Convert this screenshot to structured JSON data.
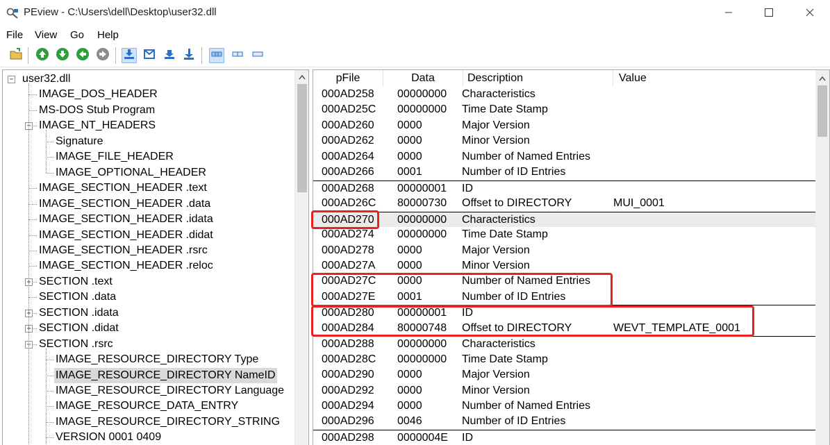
{
  "window": {
    "title": "PEview - C:\\Users\\dell\\Desktop\\user32.dll",
    "minimize_icon": "minimize-icon",
    "maximize_icon": "maximize-icon",
    "close_icon": "close-icon"
  },
  "menu": [
    "File",
    "View",
    "Go",
    "Help"
  ],
  "toolbar": {
    "buttons": [
      "open-file-icon",
      "go-up-icon",
      "go-down-icon",
      "go-back-icon",
      "go-forward-icon",
      "view-hex-icon",
      "view-text-icon",
      "view-start-icon",
      "view-end-icon",
      "view-details-icon",
      "view-list-icon",
      "view-small-icon"
    ],
    "green": "#2e9e3c",
    "blue": "#2a6fc4"
  },
  "tree": {
    "items": [
      {
        "label": "user32.dll",
        "level": 0,
        "expander": "−"
      },
      {
        "label": "IMAGE_DOS_HEADER",
        "level": 1,
        "expander": ""
      },
      {
        "label": "MS-DOS Stub Program",
        "level": 1,
        "expander": ""
      },
      {
        "label": "IMAGE_NT_HEADERS",
        "level": 1,
        "expander": "−"
      },
      {
        "label": "Signature",
        "level": 2,
        "expander": ""
      },
      {
        "label": "IMAGE_FILE_HEADER",
        "level": 2,
        "expander": ""
      },
      {
        "label": "IMAGE_OPTIONAL_HEADER",
        "level": 2,
        "expander": ""
      },
      {
        "label": "IMAGE_SECTION_HEADER .text",
        "level": 1,
        "expander": ""
      },
      {
        "label": "IMAGE_SECTION_HEADER .data",
        "level": 1,
        "expander": ""
      },
      {
        "label": "IMAGE_SECTION_HEADER .idata",
        "level": 1,
        "expander": ""
      },
      {
        "label": "IMAGE_SECTION_HEADER .didat",
        "level": 1,
        "expander": ""
      },
      {
        "label": "IMAGE_SECTION_HEADER .rsrc",
        "level": 1,
        "expander": ""
      },
      {
        "label": "IMAGE_SECTION_HEADER .reloc",
        "level": 1,
        "expander": ""
      },
      {
        "label": "SECTION .text",
        "level": 1,
        "expander": "+"
      },
      {
        "label": "SECTION .data",
        "level": 1,
        "expander": ""
      },
      {
        "label": "SECTION .idata",
        "level": 1,
        "expander": "+"
      },
      {
        "label": "SECTION .didat",
        "level": 1,
        "expander": "+"
      },
      {
        "label": "SECTION .rsrc",
        "level": 1,
        "expander": "−"
      },
      {
        "label": "IMAGE_RESOURCE_DIRECTORY Type",
        "level": 2,
        "expander": ""
      },
      {
        "label": "IMAGE_RESOURCE_DIRECTORY NameID",
        "level": 2,
        "expander": "",
        "selected": true
      },
      {
        "label": "IMAGE_RESOURCE_DIRECTORY Language",
        "level": 2,
        "expander": ""
      },
      {
        "label": "IMAGE_RESOURCE_DATA_ENTRY",
        "level": 2,
        "expander": ""
      },
      {
        "label": "IMAGE_RESOURCE_DIRECTORY_STRING",
        "level": 2,
        "expander": ""
      },
      {
        "label": "VERSION  0001  0409",
        "level": 2,
        "expander": ""
      }
    ]
  },
  "grid": {
    "columns": [
      "pFile",
      "Data",
      "Description",
      "Value"
    ],
    "rows": [
      {
        "pFile": "000AD258",
        "data": "00000000",
        "desc": "Characteristics",
        "value": ""
      },
      {
        "pFile": "000AD25C",
        "data": "00000000",
        "desc": "Time Date Stamp",
        "value": ""
      },
      {
        "pFile": "000AD260",
        "data": "0000",
        "desc": "Major Version",
        "value": ""
      },
      {
        "pFile": "000AD262",
        "data": "0000",
        "desc": "Minor Version",
        "value": ""
      },
      {
        "pFile": "000AD264",
        "data": "0000",
        "desc": "Number of Named Entries",
        "value": ""
      },
      {
        "pFile": "000AD266",
        "data": "0001",
        "desc": "Number of ID Entries",
        "value": ""
      },
      {
        "pFile": "000AD268",
        "data": "00000001",
        "desc": "ID",
        "value": "",
        "group_start": true
      },
      {
        "pFile": "000AD26C",
        "data": "80000730",
        "desc": "Offset to DIRECTORY",
        "value": "MUI_0001"
      },
      {
        "pFile": "000AD270",
        "data": "00000000",
        "desc": "Characteristics",
        "value": "",
        "group_start": true,
        "highlight": true
      },
      {
        "pFile": "000AD274",
        "data": "00000000",
        "desc": "Time Date Stamp",
        "value": ""
      },
      {
        "pFile": "000AD278",
        "data": "0000",
        "desc": "Major Version",
        "value": ""
      },
      {
        "pFile": "000AD27A",
        "data": "0000",
        "desc": "Minor Version",
        "value": ""
      },
      {
        "pFile": "000AD27C",
        "data": "0000",
        "desc": "Number of Named Entries",
        "value": ""
      },
      {
        "pFile": "000AD27E",
        "data": "0001",
        "desc": "Number of ID Entries",
        "value": ""
      },
      {
        "pFile": "000AD280",
        "data": "00000001",
        "desc": "ID",
        "value": "",
        "group_start": true
      },
      {
        "pFile": "000AD284",
        "data": "80000748",
        "desc": "Offset to DIRECTORY",
        "value": "WEVT_TEMPLATE_0001"
      },
      {
        "pFile": "000AD288",
        "data": "00000000",
        "desc": "Characteristics",
        "value": "",
        "group_start": true
      },
      {
        "pFile": "000AD28C",
        "data": "00000000",
        "desc": "Time Date Stamp",
        "value": ""
      },
      {
        "pFile": "000AD290",
        "data": "0000",
        "desc": "Major Version",
        "value": ""
      },
      {
        "pFile": "000AD292",
        "data": "0000",
        "desc": "Minor Version",
        "value": ""
      },
      {
        "pFile": "000AD294",
        "data": "0000",
        "desc": "Number of Named Entries",
        "value": ""
      },
      {
        "pFile": "000AD296",
        "data": "0046",
        "desc": "Number of ID Entries",
        "value": ""
      },
      {
        "pFile": "000AD298",
        "data": "0000004E",
        "desc": "ID",
        "value": "",
        "group_start": true
      }
    ]
  },
  "annotation_color": "#e8231f"
}
